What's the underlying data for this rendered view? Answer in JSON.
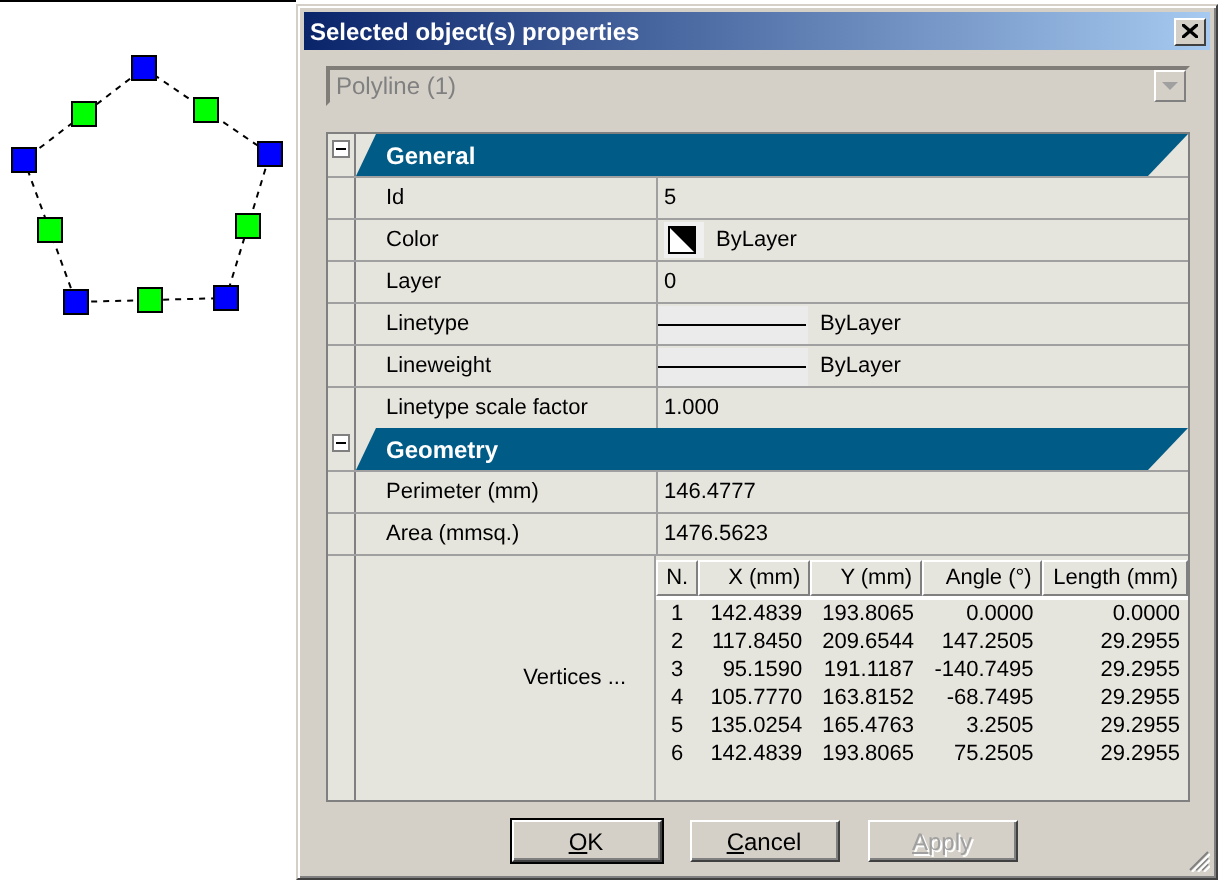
{
  "window": {
    "title": "Selected object(s) properties"
  },
  "object_select": {
    "value": "Polyline (1)",
    "disabled": true
  },
  "sections": [
    {
      "title": "General",
      "expanded": true,
      "properties": [
        {
          "name": "Id",
          "value": "5",
          "kind": "text"
        },
        {
          "name": "Color",
          "value": "ByLayer",
          "kind": "color"
        },
        {
          "name": "Layer",
          "value": "0",
          "kind": "text"
        },
        {
          "name": "Linetype",
          "value": "ByLayer",
          "kind": "line"
        },
        {
          "name": "Lineweight",
          "value": "ByLayer",
          "kind": "line"
        },
        {
          "name": "Linetype scale factor",
          "value": "1.000",
          "kind": "text"
        }
      ]
    },
    {
      "title": "Geometry",
      "expanded": true,
      "properties": [
        {
          "name": "Perimeter (mm)",
          "value": "146.4777",
          "kind": "text"
        },
        {
          "name": "Area (mmsq.)",
          "value": "1476.5623",
          "kind": "text"
        },
        {
          "name": "Vertices ...",
          "kind": "table"
        }
      ]
    }
  ],
  "vertices": {
    "columns": [
      "N.",
      "X (mm)",
      "Y (mm)",
      "Angle (°)",
      "Length (mm)"
    ],
    "rows": [
      [
        "1",
        "142.4839",
        "193.8065",
        "0.0000",
        "0.0000"
      ],
      [
        "2",
        "117.8450",
        "209.6544",
        "147.2505",
        "29.2955"
      ],
      [
        "3",
        "95.1590",
        "191.1187",
        "-140.7495",
        "29.2955"
      ],
      [
        "4",
        "105.7770",
        "163.8152",
        "-68.7495",
        "29.2955"
      ],
      [
        "5",
        "135.0254",
        "165.4763",
        "3.2505",
        "29.2955"
      ],
      [
        "6",
        "142.4839",
        "193.8065",
        "75.2505",
        "29.2955"
      ]
    ]
  },
  "buttons": [
    {
      "label": "OK",
      "default": true,
      "disabled": false
    },
    {
      "label": "Cancel",
      "default": false,
      "disabled": false
    },
    {
      "label": "Apply",
      "default": false,
      "disabled": true
    }
  ]
}
